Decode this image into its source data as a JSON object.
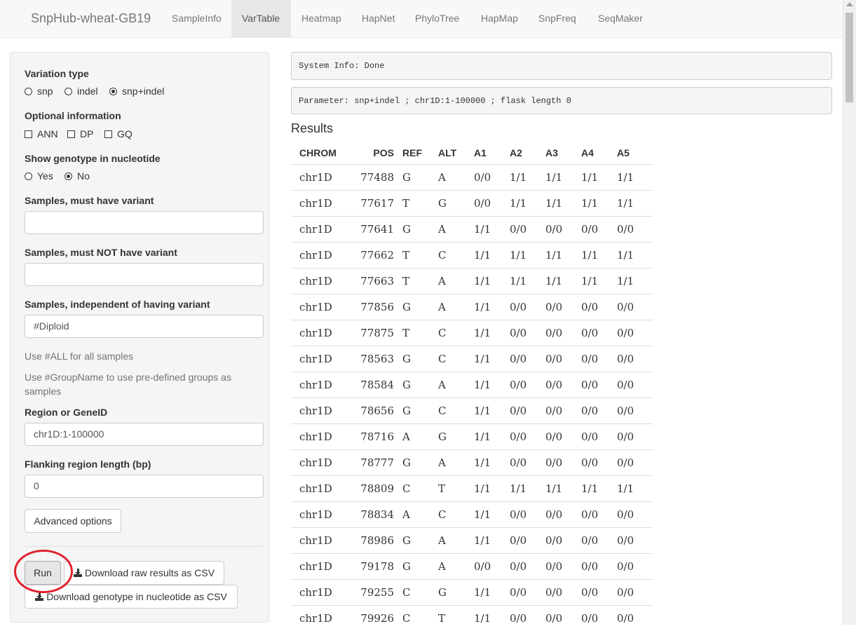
{
  "navbar": {
    "brand": "SnpHub-wheat-GB19",
    "tabs": [
      {
        "label": "SampleInfo"
      },
      {
        "label": "VarTable"
      },
      {
        "label": "Heatmap"
      },
      {
        "label": "HapNet"
      },
      {
        "label": "PhyloTree"
      },
      {
        "label": "HapMap"
      },
      {
        "label": "SnpFreq"
      },
      {
        "label": "SeqMaker"
      }
    ],
    "active_tab": "VarTable"
  },
  "sidebar": {
    "variation_type": {
      "label": "Variation type",
      "options": [
        "snp",
        "indel",
        "snp+indel"
      ],
      "selected": "snp+indel"
    },
    "optional_info": {
      "label": "Optional information",
      "options": [
        "ANN",
        "DP",
        "GQ"
      ],
      "checked": []
    },
    "show_genotype": {
      "label": "Show genotype in nucleotide",
      "options": [
        "Yes",
        "No"
      ],
      "selected": "No"
    },
    "must_have": {
      "label": "Samples, must have variant",
      "value": ""
    },
    "must_not_have": {
      "label": "Samples, must NOT have variant",
      "value": ""
    },
    "independent": {
      "label": "Samples, independent of having variant",
      "value": "#Diploid"
    },
    "help1": "Use #ALL for all samples",
    "help2": "Use #GroupName to use pre-defined groups as samples",
    "region": {
      "label": "Region or GeneID",
      "value": "chr1D:1-100000"
    },
    "flanking": {
      "label": "Flanking region length (bp)",
      "value": "0"
    },
    "advanced_label": "Advanced options",
    "run_label": "Run",
    "download_raw_label": "Download raw results as CSV",
    "download_genotype_label": "Download genotype in nucleotide as CSV"
  },
  "main": {
    "system_info": "System Info: Done",
    "parameter": "Parameter: snp+indel ; chr1D:1-100000 ; flask length 0",
    "results_title": "Results",
    "columns": [
      "CHROM",
      "POS",
      "REF",
      "ALT",
      "A1",
      "A2",
      "A3",
      "A4",
      "A5"
    ],
    "rows": [
      [
        "chr1D",
        "77488",
        "G",
        "A",
        "0/0",
        "1/1",
        "1/1",
        "1/1",
        "1/1"
      ],
      [
        "chr1D",
        "77617",
        "T",
        "G",
        "0/0",
        "1/1",
        "1/1",
        "1/1",
        "1/1"
      ],
      [
        "chr1D",
        "77641",
        "G",
        "A",
        "1/1",
        "0/0",
        "0/0",
        "0/0",
        "0/0"
      ],
      [
        "chr1D",
        "77662",
        "T",
        "C",
        "1/1",
        "1/1",
        "1/1",
        "1/1",
        "1/1"
      ],
      [
        "chr1D",
        "77663",
        "T",
        "A",
        "1/1",
        "1/1",
        "1/1",
        "1/1",
        "1/1"
      ],
      [
        "chr1D",
        "77856",
        "G",
        "A",
        "1/1",
        "0/0",
        "0/0",
        "0/0",
        "0/0"
      ],
      [
        "chr1D",
        "77875",
        "T",
        "C",
        "1/1",
        "0/0",
        "0/0",
        "0/0",
        "0/0"
      ],
      [
        "chr1D",
        "78563",
        "G",
        "C",
        "1/1",
        "0/0",
        "0/0",
        "0/0",
        "0/0"
      ],
      [
        "chr1D",
        "78584",
        "G",
        "A",
        "1/1",
        "0/0",
        "0/0",
        "0/0",
        "0/0"
      ],
      [
        "chr1D",
        "78656",
        "G",
        "C",
        "1/1",
        "0/0",
        "0/0",
        "0/0",
        "0/0"
      ],
      [
        "chr1D",
        "78716",
        "A",
        "G",
        "1/1",
        "0/0",
        "0/0",
        "0/0",
        "0/0"
      ],
      [
        "chr1D",
        "78777",
        "G",
        "A",
        "1/1",
        "0/0",
        "0/0",
        "0/0",
        "0/0"
      ],
      [
        "chr1D",
        "78809",
        "C",
        "T",
        "1/1",
        "1/1",
        "1/1",
        "1/1",
        "1/1"
      ],
      [
        "chr1D",
        "78834",
        "A",
        "C",
        "1/1",
        "0/0",
        "0/0",
        "0/0",
        "0/0"
      ],
      [
        "chr1D",
        "78986",
        "G",
        "A",
        "1/1",
        "0/0",
        "0/0",
        "0/0",
        "0/0"
      ],
      [
        "chr1D",
        "79178",
        "G",
        "A",
        "0/0",
        "0/0",
        "0/0",
        "0/0",
        "0/0"
      ],
      [
        "chr1D",
        "79255",
        "C",
        "G",
        "1/1",
        "0/0",
        "0/0",
        "0/0",
        "0/0"
      ],
      [
        "chr1D",
        "79926",
        "C",
        "T",
        "1/1",
        "0/0",
        "0/0",
        "0/0",
        "0/0"
      ]
    ]
  },
  "colors": {
    "navbar_bg": "#f8f8f8",
    "active_tab_bg": "#e7e7e7",
    "sidebar_bg": "#f5f5f5",
    "annotation_circle": "#e0202c"
  },
  "icons": [
    "download-icon",
    "scroll-up-arrow-icon"
  ]
}
